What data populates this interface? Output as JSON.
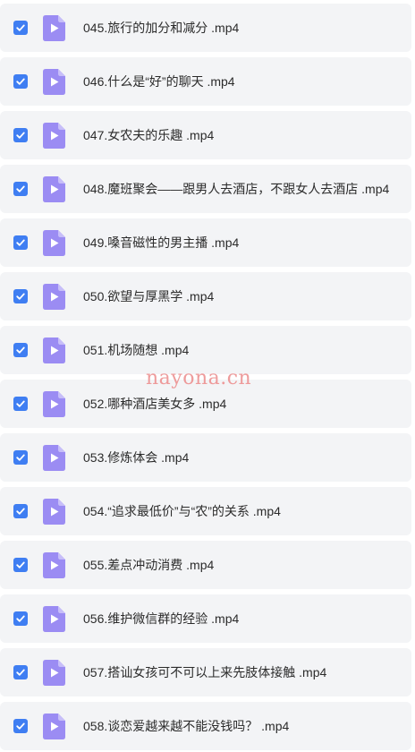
{
  "accent_color": "#3f7ef2",
  "file_icon_color": "#9b8cf3",
  "files": [
    {
      "name": "045.旅行的加分和减分 .mp4",
      "checked": true
    },
    {
      "name": "046.什么是“好”的聊天 .mp4",
      "checked": true
    },
    {
      "name": "047.女农夫的乐趣 .mp4",
      "checked": true
    },
    {
      "name": "048.魔班聚会——跟男人去酒店，不跟女人去酒店 .mp4",
      "checked": true
    },
    {
      "name": "049.嗓音磁性的男主播 .mp4",
      "checked": true
    },
    {
      "name": "050.欲望与厚黑学 .mp4",
      "checked": true
    },
    {
      "name": "051.机场随想 .mp4",
      "checked": true
    },
    {
      "name": "052.哪种酒店美女多 .mp4",
      "checked": true
    },
    {
      "name": "053.修炼体会 .mp4",
      "checked": true
    },
    {
      "name": "054.“追求最低价”与“农”的关系 .mp4",
      "checked": true
    },
    {
      "name": "055.差点冲动消费 .mp4",
      "checked": true
    },
    {
      "name": "056.维护微信群的经验 .mp4",
      "checked": true
    },
    {
      "name": "057.搭讪女孩可不可以上来先肢体接触 .mp4",
      "checked": true
    },
    {
      "name": "058.谈恋爱越来越不能没钱吗？ .mp4",
      "checked": true
    }
  ],
  "watermark": "nayona.cn"
}
